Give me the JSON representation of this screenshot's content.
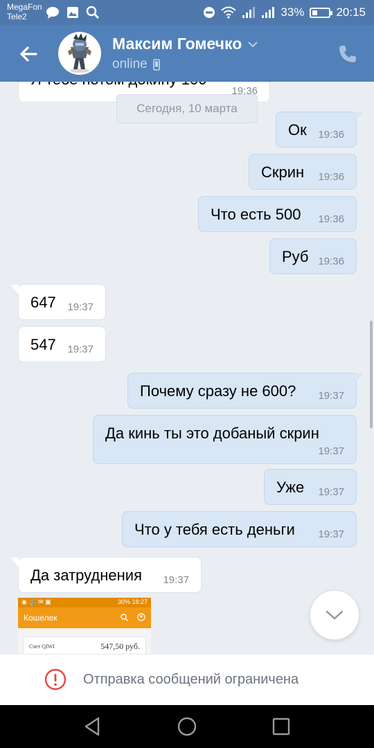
{
  "status_bar": {
    "carrier_1": "MegaFon",
    "carrier_2": "Tele2",
    "battery": "33%",
    "battery_level": 0.33,
    "time": "20:15"
  },
  "header": {
    "contact_name": "Максим Гомечко",
    "status": "online"
  },
  "chat": {
    "cut_message": {
      "text": "Я тебе потом докину 100",
      "time": "19:36"
    },
    "date_separator": "Сегодня, 10 марта",
    "messages": [
      {
        "dir": "out",
        "text": "Ок",
        "time": "19:36"
      },
      {
        "dir": "out",
        "text": "Скрин",
        "time": "19:36"
      },
      {
        "dir": "out",
        "text": "Что есть 500",
        "time": "19:36"
      },
      {
        "dir": "out",
        "text": "Руб",
        "time": "19:36"
      },
      {
        "dir": "in",
        "text": "647",
        "time": "19:37"
      },
      {
        "dir": "in",
        "text": "547",
        "time": "19:37"
      },
      {
        "dir": "out",
        "text": "Почему сразу не 600?",
        "time": "19:37"
      },
      {
        "dir": "out",
        "text": "Да кинь ты это добаный скрин",
        "time": "19:37"
      },
      {
        "dir": "out",
        "text": "Уже",
        "time": "19:37"
      },
      {
        "dir": "out",
        "text": "Что у тебя есть деньги",
        "time": "19:37"
      },
      {
        "dir": "in",
        "text": "Да затруднения",
        "time": "19:37"
      }
    ],
    "attachment": {
      "status_time": "18:27",
      "status_battery": "30%",
      "title": "Кошелек",
      "account_label": "Счет QIWI",
      "balance": "547,50 руб."
    }
  },
  "footer": {
    "restriction_text": "Отправка сообщений ограничена"
  },
  "colors": {
    "header": "#5181b8",
    "status_bar": "#4f79ad",
    "background": "#eaeef3",
    "outgoing_bubble": "#d8e6f5",
    "incoming_bubble": "#ffffff",
    "restriction_icon": "#e64646",
    "qiwi_orange": "#f29a16"
  }
}
